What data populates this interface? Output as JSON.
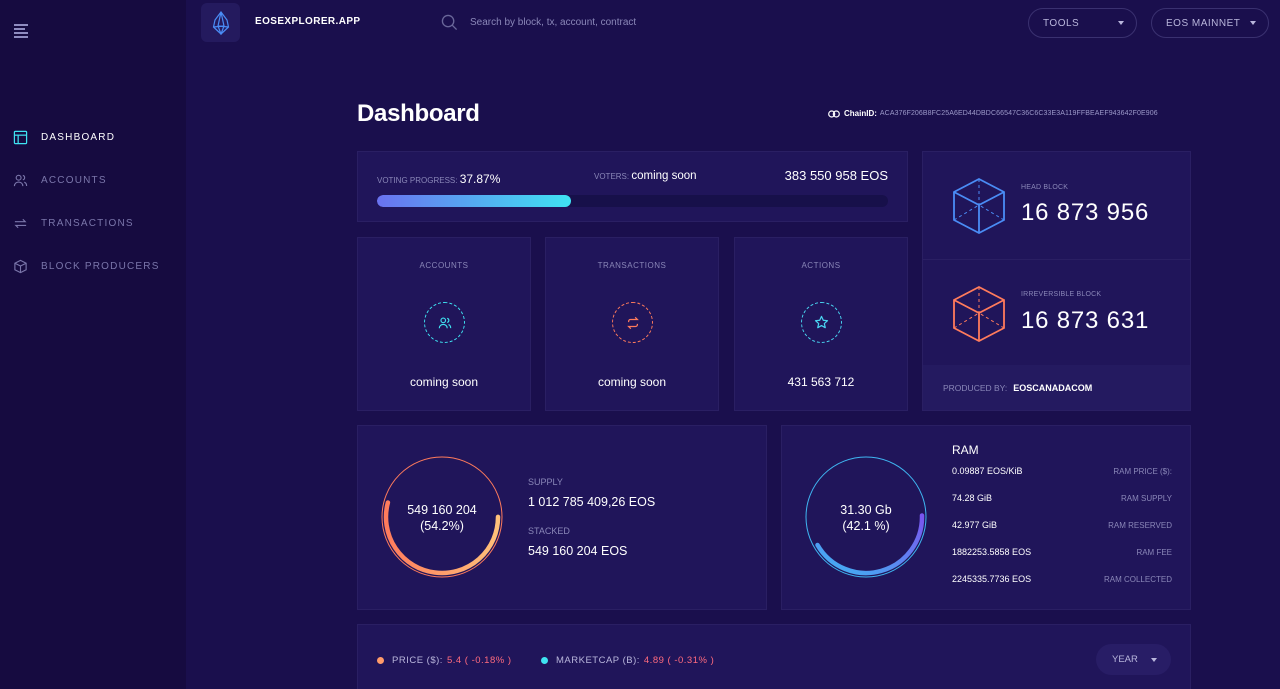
{
  "brand": "EOSEXPLORER.APP",
  "search": {
    "placeholder": "Search by block, tx, account, contract"
  },
  "dropdowns": {
    "tools": "TOOLS",
    "network": "EOS MAINNET"
  },
  "sidebar": {
    "items": [
      {
        "label": "DASHBOARD",
        "icon": "dashboard-icon",
        "active": true
      },
      {
        "label": "ACCOUNTS",
        "icon": "users-icon",
        "active": false
      },
      {
        "label": "TRANSACTIONS",
        "icon": "transfer-icon",
        "active": false
      },
      {
        "label": "BLOCK PRODUCERS",
        "icon": "box-icon",
        "active": false
      }
    ]
  },
  "page": {
    "title": "Dashboard",
    "chain_label": "ChainID:",
    "chain_id": "ACA376F206B8FC25A6ED44DBDC66547C36C6C33E3A119FFBEAEF943642F0E906"
  },
  "voting": {
    "progress_label": "VOTING PROGRESS:",
    "progress_value": "37.87%",
    "progress_fraction": 0.3787,
    "voters_label": "VOTERS:",
    "voters_value": "coming soon",
    "total": "383 550 958 EOS"
  },
  "stats": {
    "accounts": {
      "label": "ACCOUNTS",
      "value": "coming soon"
    },
    "transactions": {
      "label": "TRANSACTIONS",
      "value": "coming soon"
    },
    "actions": {
      "label": "ACTIONS",
      "value": "431 563 712"
    }
  },
  "blocks": {
    "head_label": "HEAD BLOCK",
    "head_value": "16 873 956",
    "irreversible_label": "IRREVERSIBLE BLOCK",
    "irreversible_value": "16 873 631",
    "producer_label": "PRODUCED BY:",
    "producer_value": "EOSCANADACOM"
  },
  "supply": {
    "ring_value": "549 160 204",
    "ring_percent": "(54.2%)",
    "fraction": 0.542,
    "supply_label": "SUPPLY",
    "supply_value": "1 012 785 409,26 EOS",
    "staked_label": "STACKED",
    "staked_value": "549 160 204 EOS"
  },
  "ram": {
    "title": "RAM",
    "ring_value": "31.30 Gb",
    "ring_percent": "(42.1 %)",
    "fraction": 0.421,
    "rows": [
      {
        "value": "0.09887 EOS/KiB",
        "label": "RAM PRICE ($):"
      },
      {
        "value": "74.28 GiB",
        "label": "RAM SUPPLY"
      },
      {
        "value": "42.977 GiB",
        "label": "RAM RESERVED"
      },
      {
        "value": "1882253.5858 EOS",
        "label": "RAM FEE"
      },
      {
        "value": "2245335.7736 EOS",
        "label": "RAM COLLECTED"
      }
    ]
  },
  "market": {
    "price_label": "PRICE ($):",
    "price_value": "5.4 ( -0.18% )",
    "marketcap_label": "MARKETCAP (B):",
    "marketcap_value": "4.89 ( -0.31% )",
    "period": "YEAR"
  },
  "colors": {
    "background": "#1a0f4d",
    "card": "#20155a",
    "accent_cyan": "#3fe3f2",
    "accent_blue": "#4a8cf5",
    "accent_orange": "#ff7b5c",
    "accent_purple": "#6a6af0",
    "negative": "#ff6b7e"
  }
}
